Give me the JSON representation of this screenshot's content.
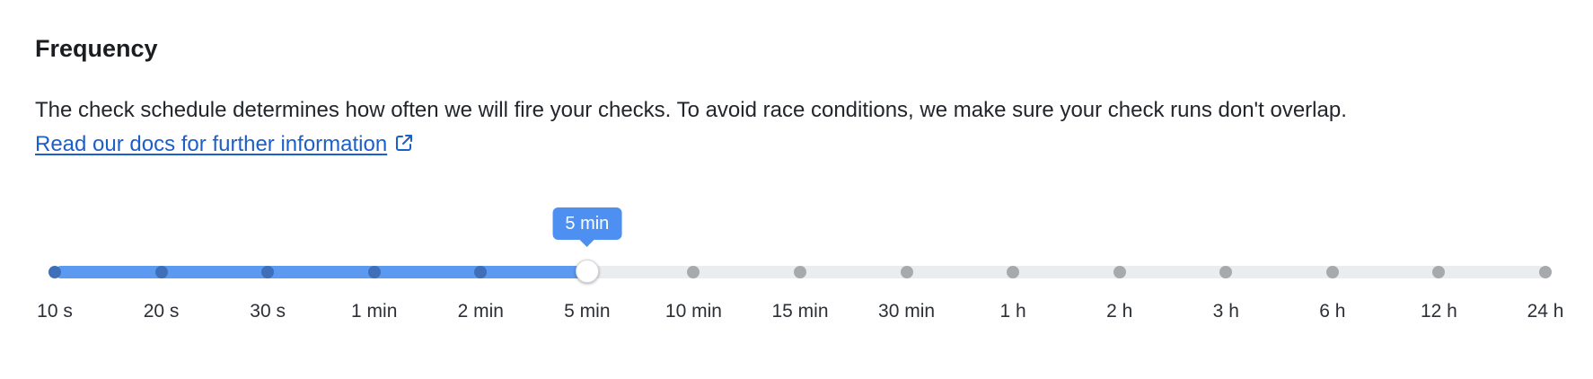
{
  "frequency": {
    "title": "Frequency",
    "description": "The check schedule determines how often we will fire your checks. To avoid race conditions, we make sure your check runs don't overlap.",
    "docs_link": {
      "label": "Read our docs for further information",
      "icon": "external-link-icon"
    },
    "slider": {
      "options": [
        "10 s",
        "20 s",
        "30 s",
        "1 min",
        "2 min",
        "5 min",
        "10 min",
        "15 min",
        "30 min",
        "1 h",
        "2 h",
        "3 h",
        "6 h",
        "12 h",
        "24 h"
      ],
      "selected_index": 5,
      "selected_label": "5 min",
      "colors": {
        "fill": "#5b9af0",
        "track": "#ebecef",
        "tooltip": "#4e8ff2",
        "dot_active": "#3f6fb8",
        "dot_inactive": "#a8a9ad"
      }
    }
  }
}
